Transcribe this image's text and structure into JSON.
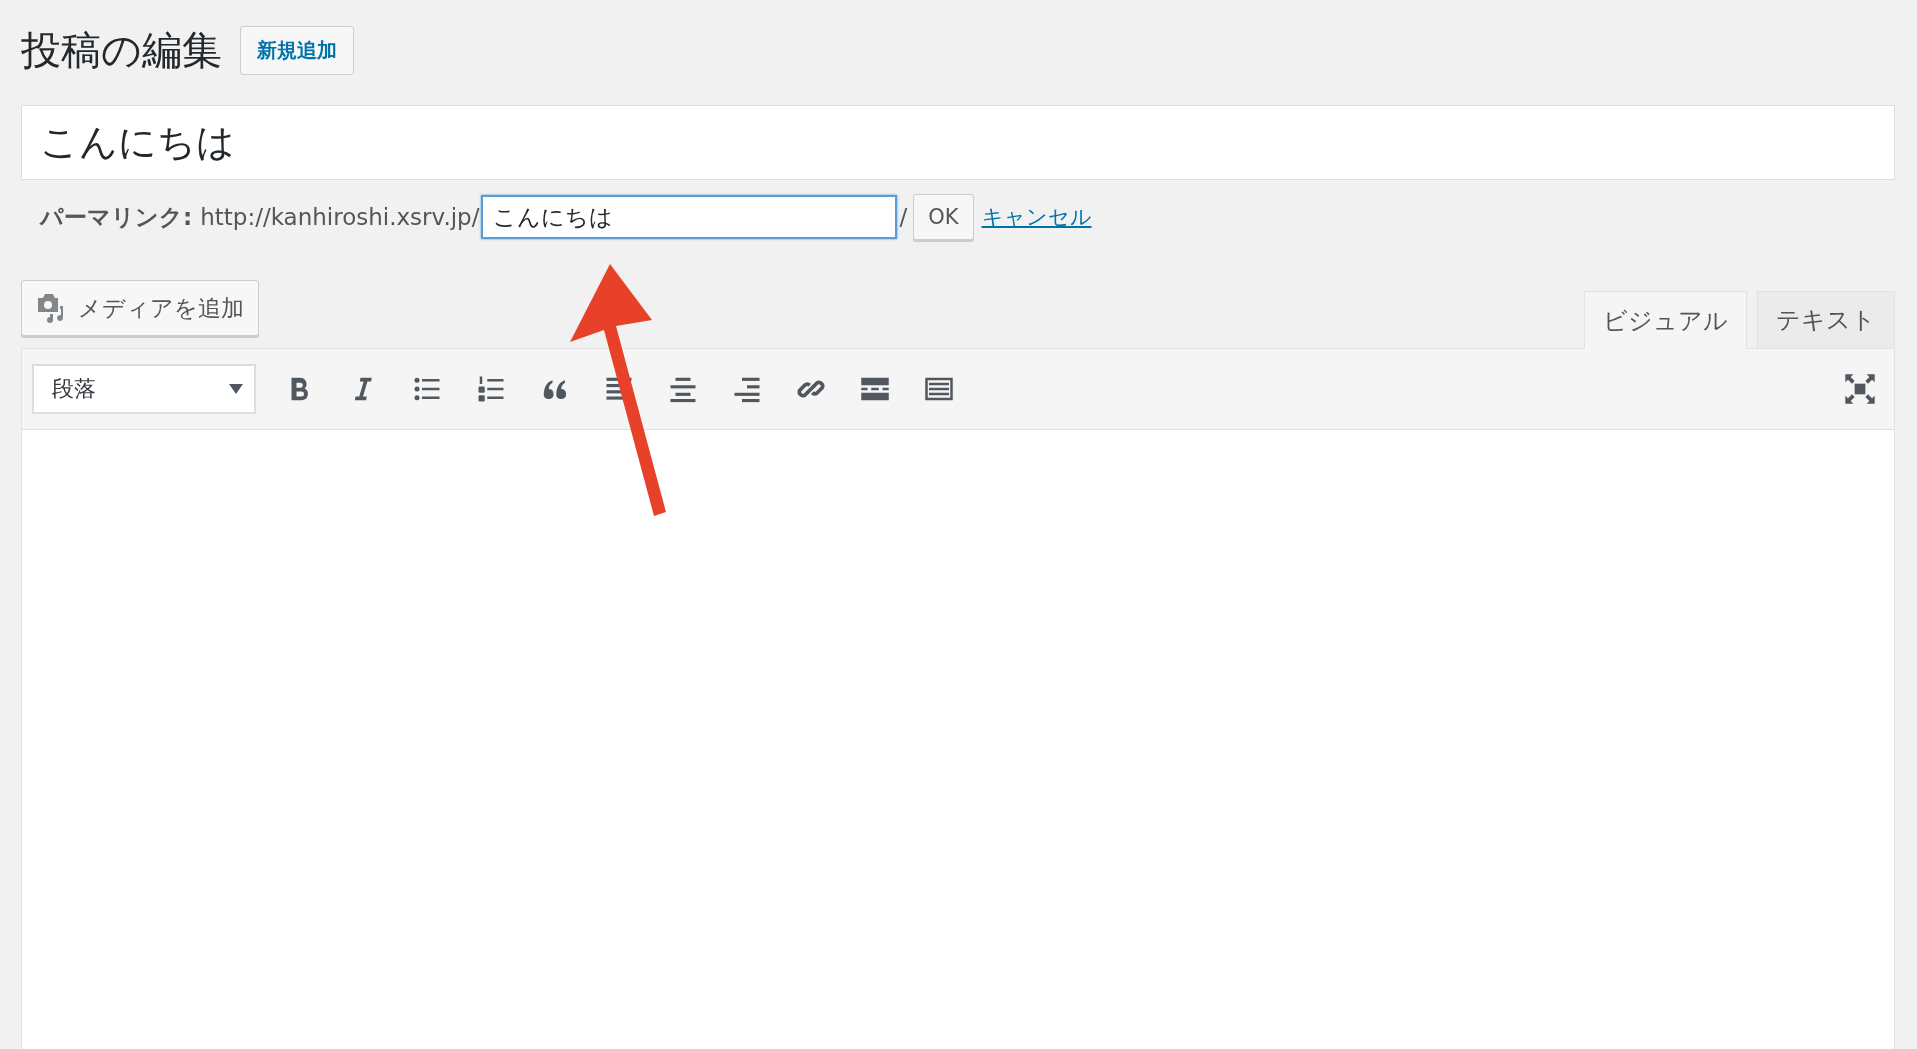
{
  "heading": "投稿の編集",
  "add_new_button": "新規追加",
  "title_field": {
    "value": "こんにちは"
  },
  "permalink": {
    "label": "パーマリンク:",
    "base_url": "http://kanhiroshi.xsrv.jp/",
    "slug": {
      "value": "こんにちは",
      "focused": true
    },
    "trailing": "/",
    "ok_button": "OK",
    "cancel_link": "キャンセル"
  },
  "media_button": "メディアを追加",
  "tabs": [
    {
      "label": "ビジュアル",
      "selected": true
    },
    {
      "label": "テキスト",
      "selected": false
    }
  ],
  "format_select": {
    "value": "段落"
  }
}
